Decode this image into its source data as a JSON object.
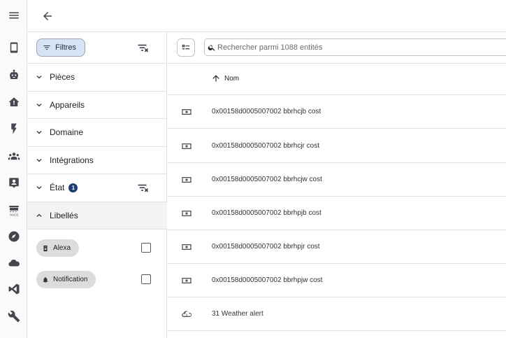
{
  "rail": {
    "items": [
      {
        "icon": "menu-icon"
      },
      {
        "icon": "phone-icon"
      },
      {
        "icon": "robot-icon"
      },
      {
        "icon": "home-alert-icon"
      },
      {
        "icon": "flash-icon"
      },
      {
        "icon": "people-icon"
      },
      {
        "icon": "badge-account-icon"
      },
      {
        "icon": "hacs-store-icon",
        "label": "HACS"
      },
      {
        "icon": "compass-icon"
      },
      {
        "icon": "cloud-icon"
      },
      {
        "icon": "vscode-icon"
      },
      {
        "icon": "wrench-icon"
      }
    ]
  },
  "filters": {
    "chip_label": "Filtres",
    "sections": [
      {
        "label": "Pièces"
      },
      {
        "label": "Appareils"
      },
      {
        "label": "Domaine"
      },
      {
        "label": "Intégrations"
      },
      {
        "label": "État",
        "badge": "1"
      },
      {
        "label": "Libellés"
      }
    ],
    "labels": [
      {
        "label": "Alexa",
        "icon": "speaker-icon"
      },
      {
        "label": "Notification",
        "icon": "bell-icon"
      }
    ]
  },
  "search": {
    "placeholder": "Rechercher parmi 1088 entités"
  },
  "table": {
    "sort_label": "Nom",
    "rows": [
      {
        "name": "0x00158d0005007002 bbrhcjb cost",
        "icon": "cash-icon"
      },
      {
        "name": "0x00158d0005007002 bbrhcjr cost",
        "icon": "cash-icon"
      },
      {
        "name": "0x00158d0005007002 bbrhcjw cost",
        "icon": "cash-icon"
      },
      {
        "name": "0x00158d0005007002 bbrhpjb cost",
        "icon": "cash-icon"
      },
      {
        "name": "0x00158d0005007002 bbrhpjr cost",
        "icon": "cash-icon"
      },
      {
        "name": "0x00158d0005007002 bbrhpjw cost",
        "icon": "cash-icon"
      },
      {
        "name": "31 Weather alert",
        "icon": "cloud-alert-icon"
      }
    ]
  }
}
